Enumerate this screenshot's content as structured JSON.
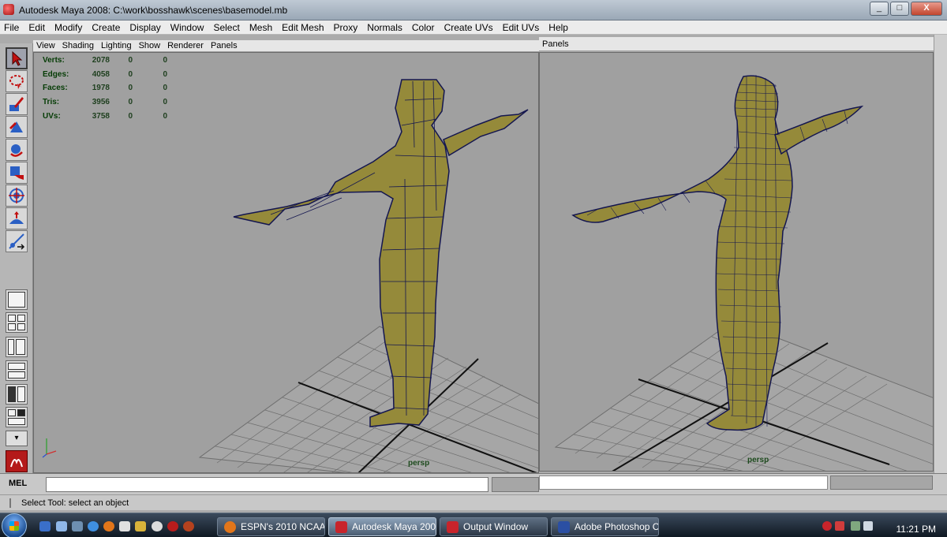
{
  "window": {
    "title": "Autodesk Maya 2008: C:\\work\\bosshawk\\scenes\\basemodel.mb",
    "minimize": "_",
    "maximize": "□",
    "close": "X"
  },
  "menu": [
    "File",
    "Edit",
    "Modify",
    "Create",
    "Display",
    "Window",
    "Select",
    "Mesh",
    "Edit Mesh",
    "Proxy",
    "Normals",
    "Color",
    "Create UVs",
    "Edit UVs",
    "Help"
  ],
  "left_panel_menu": [
    "View",
    "Shading",
    "Lighting",
    "Show",
    "Renderer",
    "Panels"
  ],
  "right_panel_menu": [
    "Panels"
  ],
  "hud": [
    {
      "label": "Verts:",
      "v1": "2078",
      "v2": "0",
      "v3": "0"
    },
    {
      "label": "Edges:",
      "v1": "4058",
      "v2": "0",
      "v3": "0"
    },
    {
      "label": "Faces:",
      "v1": "1978",
      "v2": "0",
      "v3": "0"
    },
    {
      "label": "Tris:",
      "v1": "3956",
      "v2": "0",
      "v3": "0"
    },
    {
      "label": "UVs:",
      "v1": "3758",
      "v2": "0",
      "v3": "0"
    }
  ],
  "viewports": {
    "left_camera": "persp",
    "right_camera": "persp"
  },
  "toolbox": {
    "tools": [
      "select-tool-icon",
      "lasso-tool-icon",
      "paint-select-tool-icon",
      "move-tool-icon",
      "rotate-tool-icon",
      "scale-tool-icon",
      "universal-manipulator-icon",
      "soft-modification-icon",
      "show-manipulator-icon"
    ],
    "layouts": [
      "single-view-layout",
      "four-view-layout",
      "persp-outliner-layout",
      "persp-graph-layout",
      "hypershade-layout",
      "persp-uv-layout"
    ],
    "more": "▾"
  },
  "command_line": {
    "label": "MEL",
    "value": "",
    "result": ""
  },
  "status_line": "Select Tool: select an object",
  "taskbar": {
    "tasks": [
      {
        "label": "ESPN's 2010 NCAA ...",
        "icon_color": "#e2761a",
        "active": false
      },
      {
        "label": "Autodesk Maya 200...",
        "icon_color": "#c8242b",
        "active": true
      },
      {
        "label": "Output Window",
        "icon_color": "#c8242b",
        "active": false
      },
      {
        "label": "Adobe Photoshop C...",
        "icon_color": "#2b4fa3",
        "active": false
      }
    ],
    "clock": "11:21 PM"
  },
  "colors": {
    "viewport_bg": "#A0A0A0",
    "mesh_fill": "#958a3a",
    "mesh_wire": "#141650",
    "hud_text": "#053c05"
  }
}
